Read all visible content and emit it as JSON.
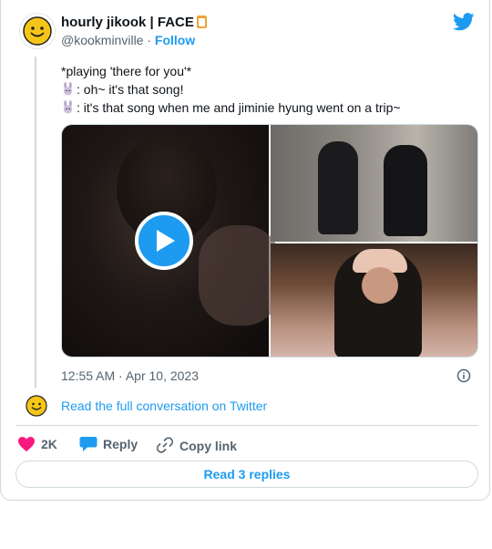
{
  "header": {
    "display_name": "hourly jikook | FACE",
    "handle": "@kookminville",
    "separator": "·",
    "follow_label": "Follow"
  },
  "tweet": {
    "line1": "*playing 'there for you'*",
    "line2": ": oh~ it's that song!",
    "line3": ": it's that song when me and jiminie hyung went on a trip~",
    "timestamp": "12:55 AM · Apr 10, 2023"
  },
  "thread": {
    "link_label": "Read the full conversation on Twitter"
  },
  "actions": {
    "like_count": "2K",
    "reply_label": "Reply",
    "copy_label": "Copy link"
  },
  "footer": {
    "read_replies_label": "Read 3 replies"
  },
  "colors": {
    "accent": "#1d9bf0",
    "like": "#f91880",
    "avatar_yellow": "#f5c518"
  },
  "icons": [
    "smiley-avatar-icon",
    "clipboard-icon",
    "twitter-bird-icon",
    "bunny-emoji-icon",
    "play-icon",
    "info-icon",
    "heart-icon",
    "reply-bubble-icon",
    "link-icon"
  ]
}
